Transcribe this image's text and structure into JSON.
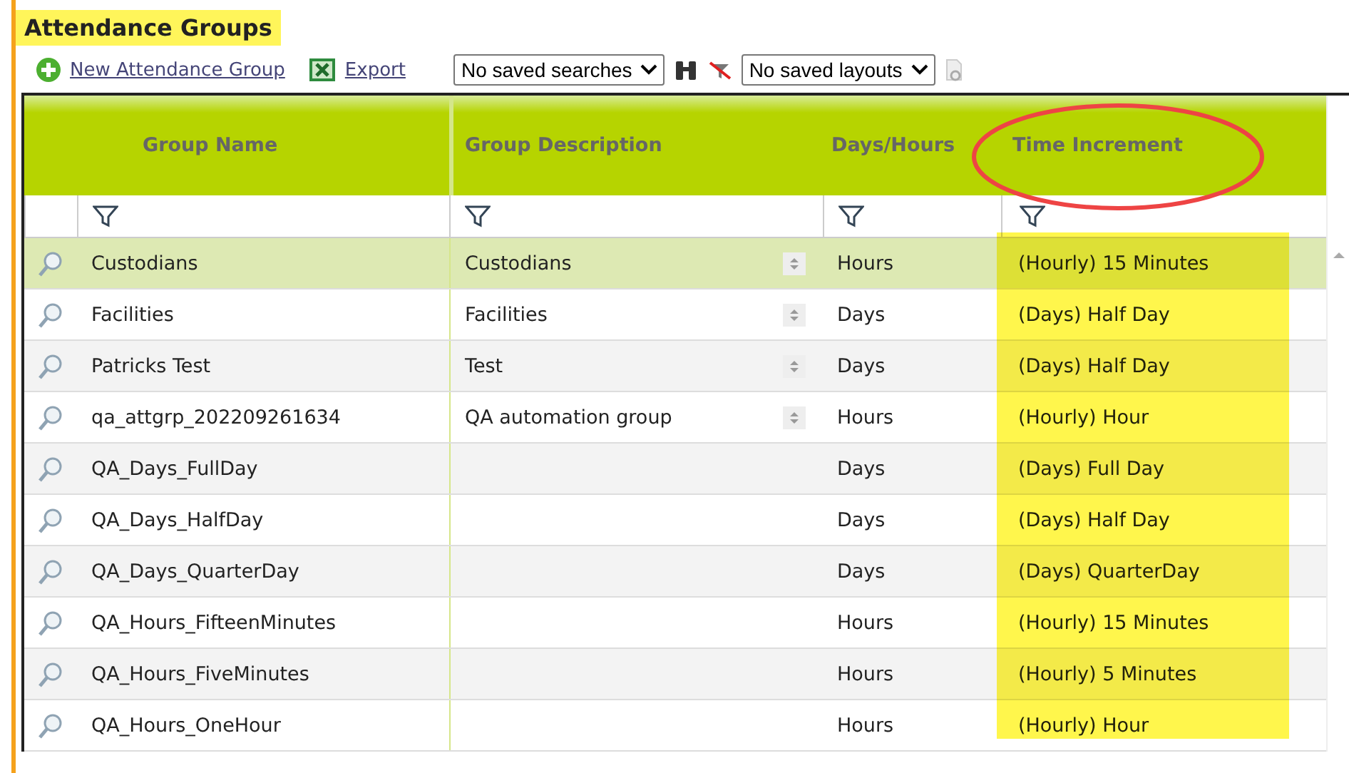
{
  "title": "Attendance Groups",
  "toolbar": {
    "new_link": "New Attendance Group",
    "export_link": "Export",
    "saved_searches": "No saved searches",
    "saved_layouts": "No saved layouts"
  },
  "table": {
    "columns": [
      "Group Name",
      "Group Description",
      "Days/Hours",
      "Time Increment"
    ],
    "rows": [
      {
        "name": "Custodians",
        "description": "Custodians",
        "has_spinner": true,
        "unit": "Hours",
        "increment": "(Hourly) 15 Minutes",
        "selected": true
      },
      {
        "name": "Facilities",
        "description": "Facilities",
        "has_spinner": true,
        "unit": "Days",
        "increment": "(Days) Half Day",
        "selected": false
      },
      {
        "name": "Patricks Test",
        "description": "Test",
        "has_spinner": true,
        "unit": "Days",
        "increment": "(Days) Half Day",
        "selected": false
      },
      {
        "name": "qa_attgrp_202209261634",
        "description": "QA automation group",
        "has_spinner": true,
        "unit": "Hours",
        "increment": "(Hourly) Hour",
        "selected": false
      },
      {
        "name": "QA_Days_FullDay",
        "has_spinner": false,
        "unit": "Days",
        "increment": "(Days) Full Day",
        "selected": false
      },
      {
        "name": "QA_Days_HalfDay",
        "has_spinner": false,
        "unit": "Days",
        "increment": "(Days) Half Day",
        "selected": false
      },
      {
        "name": "QA_Days_QuarterDay",
        "has_spinner": false,
        "unit": "Days",
        "increment": "(Days) QuarterDay",
        "selected": false
      },
      {
        "name": "QA_Hours_FifteenMinutes",
        "has_spinner": false,
        "unit": "Hours",
        "increment": "(Hourly) 15 Minutes",
        "selected": false
      },
      {
        "name": "QA_Hours_FiveMinutes",
        "has_spinner": false,
        "unit": "Hours",
        "increment": "(Hourly) 5 Minutes",
        "selected": false
      },
      {
        "name": "QA_Hours_OneHour",
        "has_spinner": false,
        "unit": "Hours",
        "increment": "(Hourly) Hour",
        "selected": false
      }
    ]
  }
}
